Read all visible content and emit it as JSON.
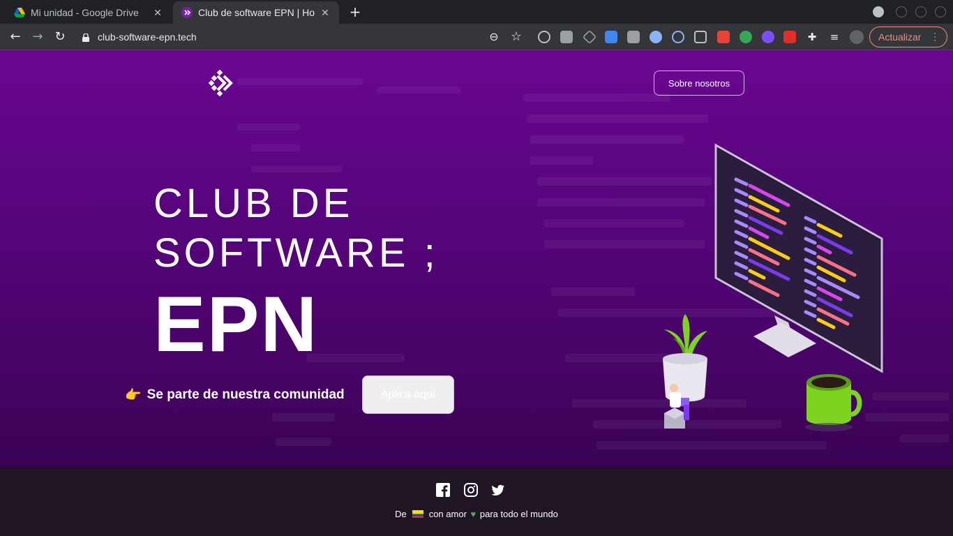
{
  "browser": {
    "tabs": [
      {
        "title": "Mi unidad - Google Drive",
        "active": false
      },
      {
        "title": "Club de software EPN | Ho",
        "active": true
      }
    ],
    "url": "club-software-epn.tech",
    "update_label": "Actualizar"
  },
  "nav": {
    "about_label": "Sobre nosotros"
  },
  "hero": {
    "title_line1": "CLUB DE",
    "title_line2": "SOFTWARE ;",
    "title_line3": "EPN",
    "cta_emoji": "👉",
    "cta_text": "Se parte de nuestra comunidad",
    "apply_label": "Aplica aquí"
  },
  "footer": {
    "prefix": "De",
    "middle": "con amor",
    "suffix": "para todo el mundo"
  },
  "colors": {
    "hero_top": "#6a0791",
    "hero_bottom": "#3b0354",
    "footer_bg": "#1f1523",
    "update_accent": "#f28b82"
  }
}
